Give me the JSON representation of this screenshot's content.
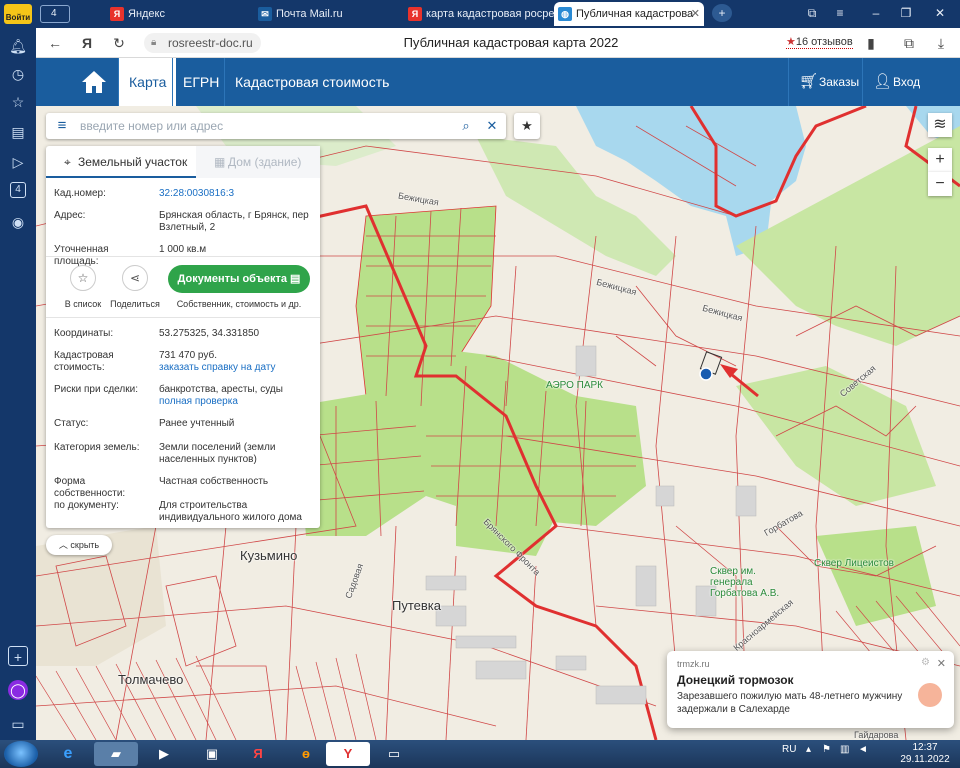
{
  "browser": {
    "login_label": "Войти",
    "rail_badge": "4",
    "tabs": [
      {
        "label": "Яндекс",
        "icon": "yandex-icon"
      },
      {
        "label": "Почта Mail.ru",
        "icon": "mail-icon"
      },
      {
        "label": "карта кадастровая росрее",
        "icon": "yandex-icon"
      },
      {
        "label": "Публичная кадастрова",
        "icon": "globe-icon"
      }
    ],
    "tab_counter": "4",
    "url": "rosreestr-doc.ru",
    "page_title": "Публичная кадастровая карта 2022",
    "reviews": "16 отзывов"
  },
  "site": {
    "nav": [
      {
        "label": "Карта"
      },
      {
        "label": "ЕГРН"
      },
      {
        "label": "Кадастровая стоимость"
      }
    ],
    "orders_label": "Заказы",
    "login_label": "Вход"
  },
  "search": {
    "placeholder": "введите номер или адрес"
  },
  "panel": {
    "tab_parcel": "Земельный участок",
    "tab_building": "Дом (здание)",
    "fields": {
      "cad_num_k": "Кад.номер:",
      "cad_num_v": "32:28:0030816:3",
      "address_k": "Адрес:",
      "address_v": "Брянская область, г Брянск, пер Взлетный, 2",
      "area_k": "Уточненная площадь:",
      "area_v": "1 000 кв.м",
      "coords_k": "Координаты:",
      "coords_v": "53.275325, 34.331850",
      "cost_k": "Кадастровая стоимость:",
      "cost_v": "731 470 руб.",
      "cost_link": "заказать справку на дату",
      "risks_k": "Риски при сделки:",
      "risks_v": "банкротства, аресты, суды",
      "risks_link": "полная проверка",
      "status_k": "Статус:",
      "status_v": "Ранее учтенный",
      "category_k": "Категория земель:",
      "category_v": "Земли поселений (земли населенных пунктов)",
      "ownership_k": "Форма собственности:",
      "ownership_v": "Частная собственность",
      "doc_k": "по документу:",
      "doc_v": "Для строительства индивидуального жилого дома"
    },
    "btn_list": "В список",
    "btn_share": "Поделиться",
    "btn_docs": "Документы объекта",
    "docs_sub": "Собственник, стоимость и др.",
    "hide": "скрыть"
  },
  "map_labels": {
    "kuzmino": "Кузьмино",
    "putevka": "Путевка",
    "tolmachevo": "Толмачево",
    "aero": "АЭРО ПАРК",
    "square1": "Сквер им. генерала Горбатова А.В.",
    "square2": "Сквер Лицеистов",
    "st1": "Бежицкая",
    "st2": "Бежицкая",
    "st3": "Бежицкая",
    "st4": "Брянского Фронта",
    "st5": "Садовая",
    "st6": "Горбатова",
    "st7": "Советская",
    "st8": "Красноармейская",
    "st9": "Гайдарова"
  },
  "notification": {
    "source": "trmzk.ru",
    "title": "Донецкий тормозок",
    "body": "Зарезавшего пожилую мать 48-летнего мужчину задержали в Салехарде"
  },
  "taskbar": {
    "lang": "RU",
    "time": "12:37",
    "date": "29.11.2022"
  },
  "colors": {
    "header": "#1a5d9e",
    "parcel_border": "#e03030",
    "green_area": "#b8e08a",
    "water": "#a8d8ee",
    "docs_button": "#2fa44a"
  }
}
